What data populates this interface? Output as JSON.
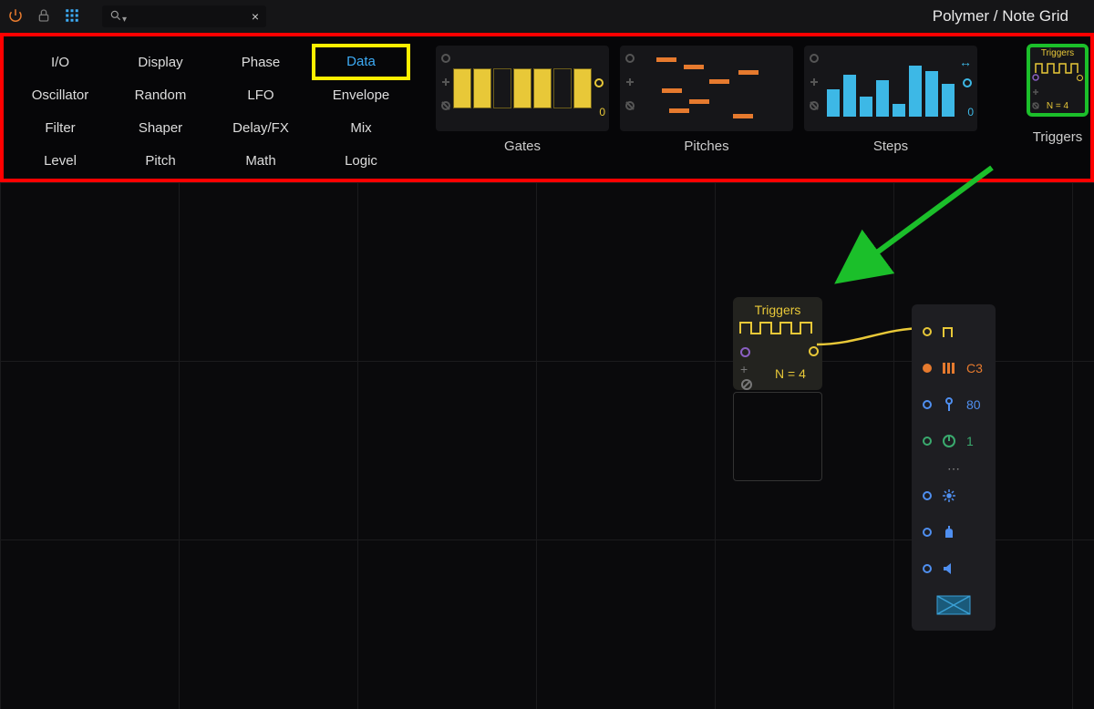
{
  "topbar": {
    "title": "Polymer / Note Grid",
    "search_placeholder": "",
    "close_label": "×"
  },
  "categories": [
    {
      "label": "I/O",
      "active": false
    },
    {
      "label": "Display",
      "active": false
    },
    {
      "label": "Phase",
      "active": false
    },
    {
      "label": "Data",
      "active": true
    },
    {
      "label": "Oscillator",
      "active": false
    },
    {
      "label": "Random",
      "active": false
    },
    {
      "label": "LFO",
      "active": false
    },
    {
      "label": "Envelope",
      "active": false
    },
    {
      "label": "Filter",
      "active": false
    },
    {
      "label": "Shaper",
      "active": false
    },
    {
      "label": "Delay/FX",
      "active": false
    },
    {
      "label": "Mix",
      "active": false
    },
    {
      "label": "Level",
      "active": false
    },
    {
      "label": "Pitch",
      "active": false
    },
    {
      "label": "Math",
      "active": false
    },
    {
      "label": "Logic",
      "active": false
    }
  ],
  "modules": {
    "gates": {
      "label": "Gates"
    },
    "pitches": {
      "label": "Pitches"
    },
    "steps": {
      "label": "Steps"
    },
    "triggers": {
      "label": "Triggers",
      "thumb_title": "Triggers",
      "thumb_count": "N = 4"
    }
  },
  "node_triggers": {
    "title": "Triggers",
    "count": "N = 4"
  },
  "side_strip": {
    "pitch_value": "C3",
    "velocity_value": "80",
    "gain_value": "1"
  },
  "annotations": {
    "browser_highlight": "red",
    "data_tab_highlight": "yellow",
    "triggers_highlight": "green"
  }
}
